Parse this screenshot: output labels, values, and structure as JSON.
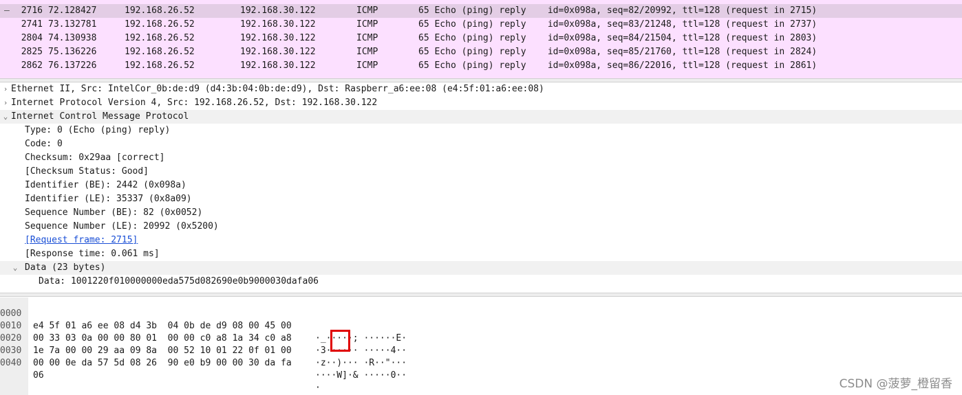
{
  "packet_list": {
    "rows": [
      {
        "no": "2716",
        "time": "72.128427",
        "source": "192.168.26.52",
        "destination": "192.168.30.122",
        "protocol": "ICMP",
        "info": "65 Echo (ping) reply    id=0x098a, seq=82/20992, ttl=128 (request in 2715)",
        "selected": true
      },
      {
        "no": "2741",
        "time": "73.132781",
        "source": "192.168.26.52",
        "destination": "192.168.30.122",
        "protocol": "ICMP",
        "info": "65 Echo (ping) reply    id=0x098a, seq=83/21248, ttl=128 (request in 2737)"
      },
      {
        "no": "2804",
        "time": "74.130938",
        "source": "192.168.26.52",
        "destination": "192.168.30.122",
        "protocol": "ICMP",
        "info": "65 Echo (ping) reply    id=0x098a, seq=84/21504, ttl=128 (request in 2803)"
      },
      {
        "no": "2825",
        "time": "75.136226",
        "source": "192.168.26.52",
        "destination": "192.168.30.122",
        "protocol": "ICMP",
        "info": "65 Echo (ping) reply    id=0x098a, seq=85/21760, ttl=128 (request in 2824)"
      },
      {
        "no": "2862",
        "time": "76.137226",
        "source": "192.168.26.52",
        "destination": "192.168.30.122",
        "protocol": "ICMP",
        "info": "65 Echo (ping) reply    id=0x098a, seq=86/22016, ttl=128 (request in 2861)"
      }
    ],
    "related_mark": "—"
  },
  "details": {
    "ethernet": "Ethernet II, Src: IntelCor_0b:de:d9 (d4:3b:04:0b:de:d9), Dst: Raspberr_a6:ee:08 (e4:5f:01:a6:ee:08)",
    "ip": "Internet Protocol Version 4, Src: 192.168.26.52, Dst: 192.168.30.122",
    "icmp": "Internet Control Message Protocol",
    "type": "Type: 0 (Echo (ping) reply)",
    "code": "Code: 0",
    "checksum": "Checksum: 0x29aa [correct]",
    "checksum_status": "[Checksum Status: Good]",
    "identifier_be": "Identifier (BE): 2442 (0x098a)",
    "identifier_le": "Identifier (LE): 35337 (0x8a09)",
    "seq_be": "Sequence Number (BE): 82 (0x0052)",
    "seq_le": "Sequence Number (LE): 20992 (0x5200)",
    "request_frame": "[Request frame: 2715]",
    "response_time": "[Response time: 0.061 ms]",
    "data_header": "Data (23 bytes)",
    "data_value": "Data: 1001220f010000000eda575d082690e0b9000030dafa06",
    "collapsed_glyph": "›",
    "expanded_glyph": "⌄"
  },
  "bytes": {
    "rows": [
      {
        "offset": "0000",
        "hex": "e4 5f 01 a6 ee 08 d4 3b  04 0b de d9 08 00 45 00",
        "ascii": "·_·····; ······E·"
      },
      {
        "offset": "0010",
        "hex": "00 33 03 0a 00 00 80 01  00 00 c0 a8 1a 34 c0 a8",
        "ascii": "·3······ ·····4··"
      },
      {
        "offset": "0020",
        "hex": "1e 7a 00 00 29 aa 09 8a  00 52 10 01 22 0f 01 00",
        "ascii": "·z··)··· ·R··\"···"
      },
      {
        "offset": "0030",
        "hex": "00 00 0e da 57 5d 08 26  90 e0 b9 00 00 30 da fa",
        "ascii": "····W]·& ·····0··"
      },
      {
        "offset": "0040",
        "hex": "06",
        "ascii": "·"
      }
    ]
  },
  "watermark": "CSDN @菠萝_橙留香",
  "colors": {
    "row_bg": "#fce0ff",
    "selected_row_bg": "#e3cde5",
    "highlight_box": "#e00000",
    "link": "#1a4fd6"
  }
}
